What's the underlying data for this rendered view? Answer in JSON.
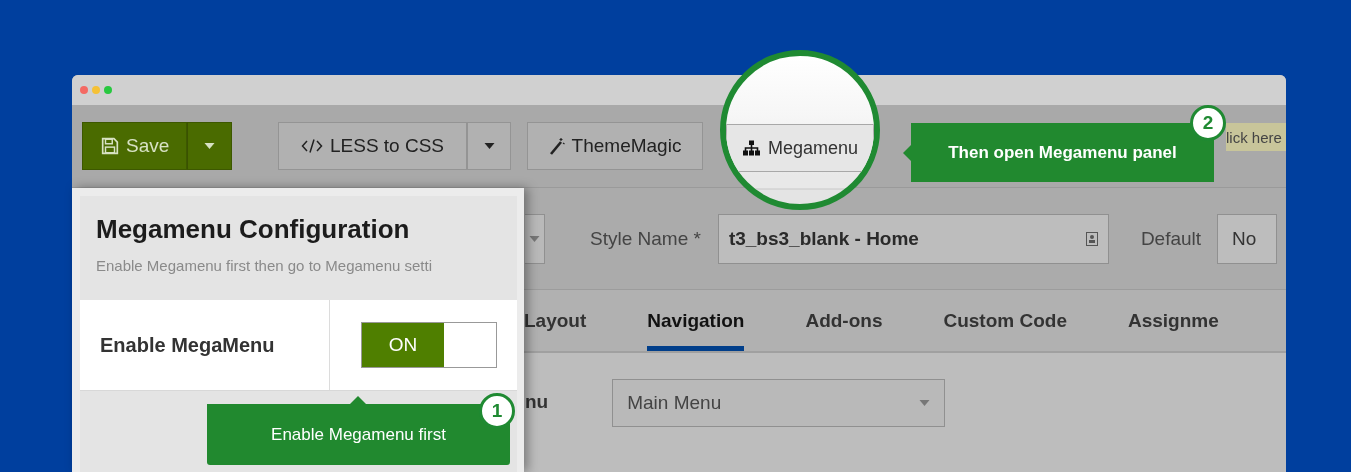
{
  "toolbar": {
    "buttons": [
      {
        "label": "Save",
        "split": true,
        "primary": true
      },
      {
        "label": "LESS to CSS",
        "split": true,
        "primary": false
      },
      {
        "label": "ThemeMagic",
        "split": false,
        "primary": false
      }
    ],
    "hint": "lick here"
  },
  "magnifier": {
    "button": {
      "label": "Megamenu"
    }
  },
  "style_form": {
    "style_name": {
      "label": "Style Name *",
      "value": "t3_bs3_blank - Home"
    },
    "default": {
      "label": "Default",
      "value": "No"
    }
  },
  "tabs": [
    {
      "label": "Layout",
      "selected": false
    },
    {
      "label": "Navigation",
      "selected": true
    },
    {
      "label": "Add-ons",
      "selected": false
    },
    {
      "label": "Custom Code",
      "selected": false
    },
    {
      "label": "Assignme",
      "selected": false
    }
  ],
  "menu_field": {
    "label": "nu",
    "value": "Main Menu"
  },
  "config_panel": {
    "title": "Megamenu Configuration",
    "subtitle": "Enable Megamenu first then go to Megamenu setti",
    "rows": [
      {
        "label": "Enable MegaMenu",
        "on": true,
        "on_label": "ON"
      }
    ]
  },
  "callouts": [
    {
      "number": "1",
      "text": "Enable Megamenu first"
    },
    {
      "number": "2",
      "text": "Then open Megamenu panel"
    }
  ]
}
